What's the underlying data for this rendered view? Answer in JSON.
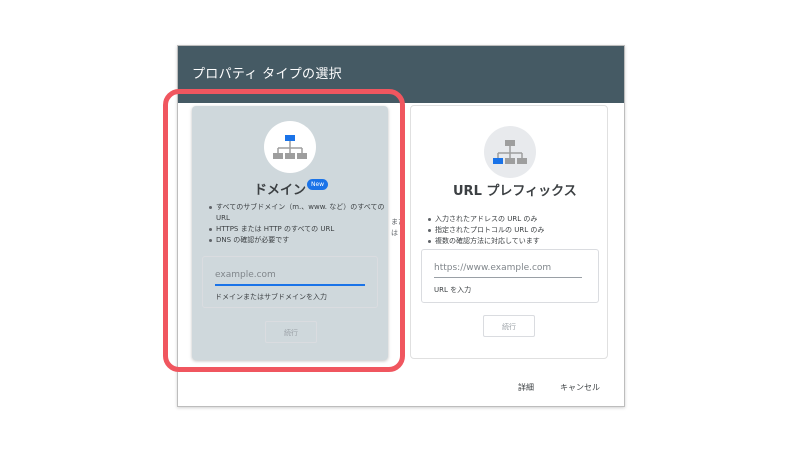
{
  "dialog": {
    "title": "プロパティ タイプの選択",
    "header_color": "#455a64"
  },
  "domain_card": {
    "icon": "sitemap-icon",
    "title": "ドメイン",
    "badge": "New",
    "bullets": [
      "すべてのサブドメイン（m.、www. など）のすべての URL",
      "HTTPS または HTTP のすべての URL",
      "DNS の確認が必要です"
    ],
    "input_placeholder": "example.com",
    "input_help": "ドメインまたはサブドメインを入力",
    "continue_label": "続行"
  },
  "or_separator": "または",
  "url_card": {
    "icon": "sitemap-icon",
    "title": "URL プレフィックス",
    "bullets": [
      "入力されたアドレスの URL のみ",
      "指定されたプロトコルの URL のみ",
      "複数の確認方法に対応しています"
    ],
    "input_placeholder": "https://www.example.com",
    "input_help": "URL を入力",
    "continue_label": "続行"
  },
  "footer": {
    "details_label": "詳細",
    "cancel_label": "キャンセル"
  },
  "colors": {
    "accent": "#1a73e8",
    "highlight": "#f0565f",
    "selected_card": "#cfd8dc"
  }
}
